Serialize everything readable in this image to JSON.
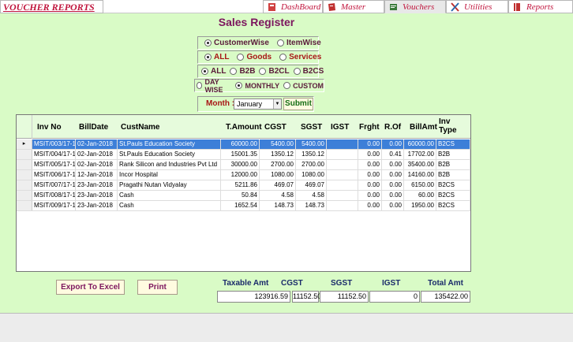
{
  "app": {
    "brand": "VOUCHER REPORTS",
    "tabs": [
      {
        "label": "DashBoard",
        "icon": "dashboard-icon"
      },
      {
        "label": "Master",
        "icon": "master-icon"
      },
      {
        "label": "Vouchers",
        "icon": "vouchers-icon"
      },
      {
        "label": "Utilities",
        "icon": "utilities-icon"
      },
      {
        "label": "Reports",
        "icon": "reports-icon"
      }
    ]
  },
  "page": {
    "title": "Sales Register"
  },
  "filters": {
    "groupBy": {
      "options": [
        "CustomerWise",
        "ItemWise"
      ],
      "selected": "CustomerWise"
    },
    "itemType": {
      "options": [
        "ALL",
        "Goods",
        "Services"
      ],
      "selected": "ALL"
    },
    "billType": {
      "options": [
        "ALL",
        "B2B",
        "B2CL",
        "B2CS"
      ],
      "selected": "ALL"
    },
    "period": {
      "options": [
        "DAY WISE",
        "MONTHLY",
        "CUSTOM"
      ],
      "selected": "MONTHLY"
    },
    "monthLabel": "Month :",
    "month": "January",
    "submitLabel": "Submit"
  },
  "grid": {
    "columns": [
      "Inv No",
      "BillDate",
      "CustName",
      "T.Amount",
      "CGST",
      "SGST",
      "IGST",
      "Frght",
      "R.Of",
      "BillAmt",
      "Inv Type"
    ],
    "rowMarker": "▸",
    "rows": [
      [
        "MSIT/003/17-18",
        "02-Jan-2018",
        "St.Pauls Education Society",
        "60000.00",
        "5400.00",
        "5400.00",
        "",
        "0.00",
        "0.00",
        "60000.00",
        "B2CS"
      ],
      [
        "MSIT/004/17-18",
        "02-Jan-2018",
        "St.Pauls Education Society",
        "15001.35",
        "1350.12",
        "1350.12",
        "",
        "0.00",
        "0.41",
        "17702.00",
        "B2B"
      ],
      [
        "MSIT/005/17-18",
        "02-Jan-2018",
        "Rank Silicon and Industries Pvt Ltd",
        "30000.00",
        "2700.00",
        "2700.00",
        "",
        "0.00",
        "0.00",
        "35400.00",
        "B2B"
      ],
      [
        "MSIT/006/17-18",
        "12-Jan-2018",
        "Incor Hospital",
        "12000.00",
        "1080.00",
        "1080.00",
        "",
        "0.00",
        "0.00",
        "14160.00",
        "B2B"
      ],
      [
        "MSIT/007/17-18",
        "23-Jan-2018",
        "Pragathi Nutan Vidyalay",
        "5211.86",
        "469.07",
        "469.07",
        "",
        "0.00",
        "0.00",
        "6150.00",
        "B2CS"
      ],
      [
        "MSIT/008/17-18",
        "23-Jan-2018",
        "Cash",
        "50.84",
        "4.58",
        "4.58",
        "",
        "0.00",
        "0.00",
        "60.00",
        "B2CS"
      ],
      [
        "MSIT/009/17-18",
        "23-Jan-2018",
        "Cash",
        "1652.54",
        "148.73",
        "148.73",
        "",
        "0.00",
        "0.00",
        "1950.00",
        "B2CS"
      ]
    ]
  },
  "actions": {
    "exportLabel": "Export To Excel",
    "printLabel": "Print"
  },
  "totals": {
    "labels": {
      "taxable": "Taxable Amt",
      "cgst": "CGST",
      "sgst": "SGST",
      "igst": "IGST",
      "total": "Total Amt"
    },
    "values": {
      "taxable": "123916.59",
      "cgst": "11152.50",
      "sgst": "11152.50",
      "igst": "0",
      "total": "135422.00"
    }
  }
}
